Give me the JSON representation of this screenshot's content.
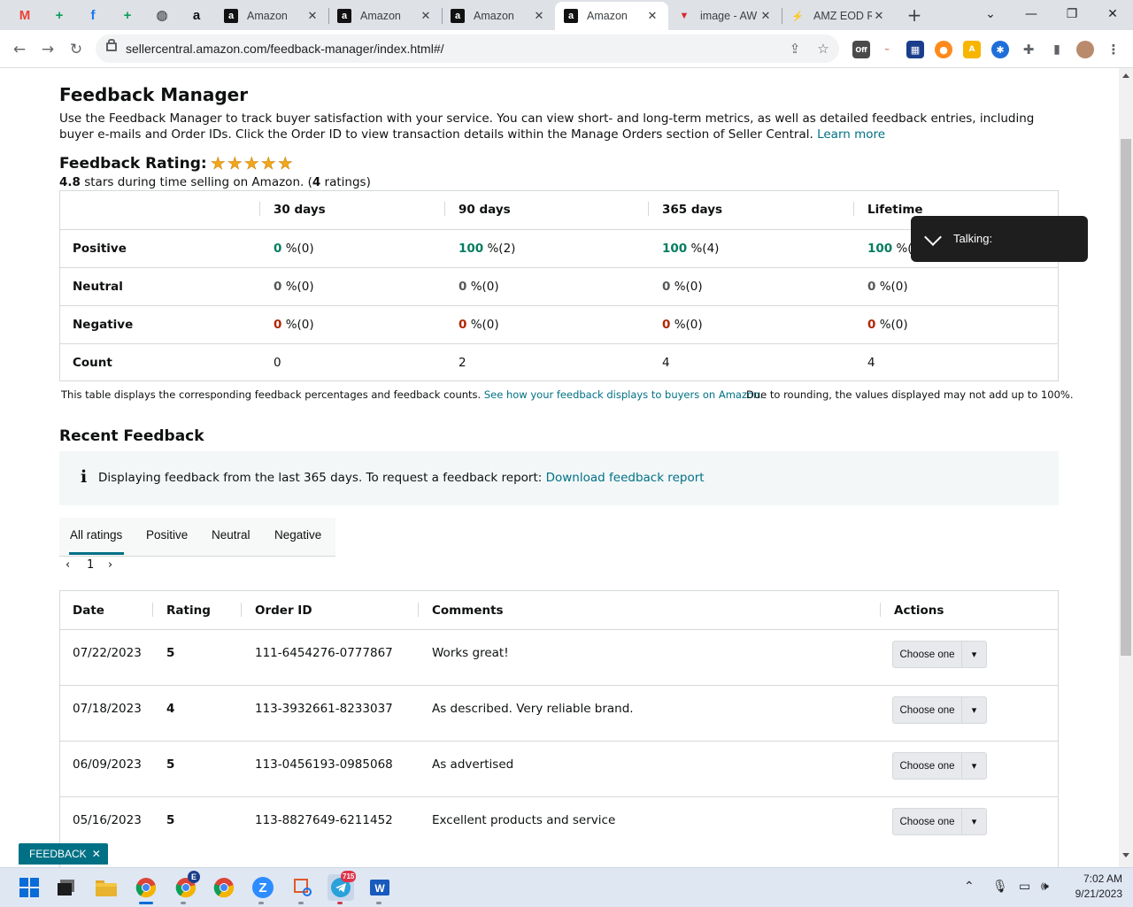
{
  "browser": {
    "pinned_tabs": [
      {
        "icon": "gmail-icon",
        "glyph": "M",
        "color": "#ea4335"
      },
      {
        "icon": "green-plus-icon",
        "glyph": "+",
        "color": "#0f9d58"
      },
      {
        "icon": "facebook-icon",
        "glyph": "f",
        "color": "#1877f2"
      },
      {
        "icon": "green-plus-icon",
        "glyph": "+",
        "color": "#0f9d58"
      },
      {
        "icon": "globe-icon",
        "glyph": "◍",
        "color": "#5f6368"
      },
      {
        "icon": "amazon-icon",
        "glyph": "a",
        "color": "#111111"
      }
    ],
    "tabs": [
      {
        "title": "Amazon",
        "icon": "amazon-icon",
        "active": false
      },
      {
        "title": "Amazon",
        "icon": "amazon-icon",
        "active": false
      },
      {
        "title": "Amazon",
        "icon": "amazon-icon",
        "active": false
      },
      {
        "title": "Amazon",
        "icon": "amazon-icon",
        "active": true
      },
      {
        "title": "image - AW",
        "icon": "v-logo-icon",
        "active": false
      },
      {
        "title": "AMZ EOD R",
        "icon": "amz-eod-icon",
        "active": false
      }
    ],
    "url": "sellercentral.amazon.com/feedback-manager/index.html#/"
  },
  "page": {
    "title": "Feedback Manager",
    "intro": "Use the Feedback Manager to track buyer satisfaction with your service. You can view short- and long-term metrics, as well as detailed feedback entries, including buyer e-mails and Order IDs. Click the Order ID to view transaction details within the Manage Orders section of Seller Central.",
    "learn_more": "Learn more",
    "rating_heading": "Feedback Rating:",
    "rating_stars": 5,
    "rating_value": "4.8",
    "rating_text_mid": " stars during time selling on Amazon. (",
    "rating_count": "4",
    "rating_text_end": " ratings)",
    "metrics": {
      "columns": [
        "30 days",
        "90 days",
        "365 days",
        "Lifetime"
      ],
      "rows": [
        {
          "label": "Positive",
          "kind": "green",
          "values": [
            [
              "0",
              " %(0)"
            ],
            [
              "100",
              " %(2)"
            ],
            [
              "100",
              " %(4)"
            ],
            [
              "100",
              " %(4)"
            ]
          ]
        },
        {
          "label": "Neutral",
          "kind": "grey",
          "values": [
            [
              "0",
              " %(0)"
            ],
            [
              "0",
              " %(0)"
            ],
            [
              "0",
              " %(0)"
            ],
            [
              "0",
              " %(0)"
            ]
          ]
        },
        {
          "label": "Negative",
          "kind": "red",
          "values": [
            [
              "0",
              " %(0)"
            ],
            [
              "0",
              " %(0)"
            ],
            [
              "0",
              " %(0)"
            ],
            [
              "0",
              " %(0)"
            ]
          ]
        },
        {
          "label": "Count",
          "kind": "plain",
          "values": [
            [
              "0",
              ""
            ],
            [
              "2",
              ""
            ],
            [
              "4",
              ""
            ],
            [
              "4",
              ""
            ]
          ]
        }
      ]
    },
    "table_note": "This table displays the corresponding feedback percentages and feedback counts.",
    "table_note_link": "See how your feedback displays to buyers on Amazon.",
    "rounding_note": "Due to rounding, the values displayed may not add up to 100%.",
    "recent_heading": "Recent Feedback",
    "info_text": "Displaying feedback from the last 365 days. To request a feedback report:",
    "info_link": "Download feedback report",
    "filter_tabs": [
      "All ratings",
      "Positive",
      "Neutral",
      "Negative"
    ],
    "pager_page": "1",
    "feedback_columns": [
      "Date",
      "Rating",
      "Order ID",
      "Comments",
      "Actions"
    ],
    "feedback_rows": [
      {
        "date": "07/22/2023",
        "rating": "5",
        "order_id": "111-6454276-0777867",
        "comment": "Works great!",
        "action": "Choose one"
      },
      {
        "date": "07/18/2023",
        "rating": "4",
        "order_id": "113-3932661-8233037",
        "comment": "As described. Very reliable brand.",
        "action": "Choose one"
      },
      {
        "date": "06/09/2023",
        "rating": "5",
        "order_id": "113-0456193-0985068",
        "comment": "As advertised",
        "action": "Choose one"
      },
      {
        "date": "05/16/2023",
        "rating": "5",
        "order_id": "113-8827649-6211452",
        "comment": "Excellent products and service",
        "action": "Choose one"
      }
    ],
    "talking_label": "Talking:",
    "feedback_badge": "FEEDBACK",
    "feedback_badge_close": "✕"
  },
  "taskbar": {
    "time": "7:02 AM",
    "date": "9/21/2023",
    "telegram_badge": "715",
    "chrome_badge_letter": "E",
    "accent_color": "#007185"
  }
}
